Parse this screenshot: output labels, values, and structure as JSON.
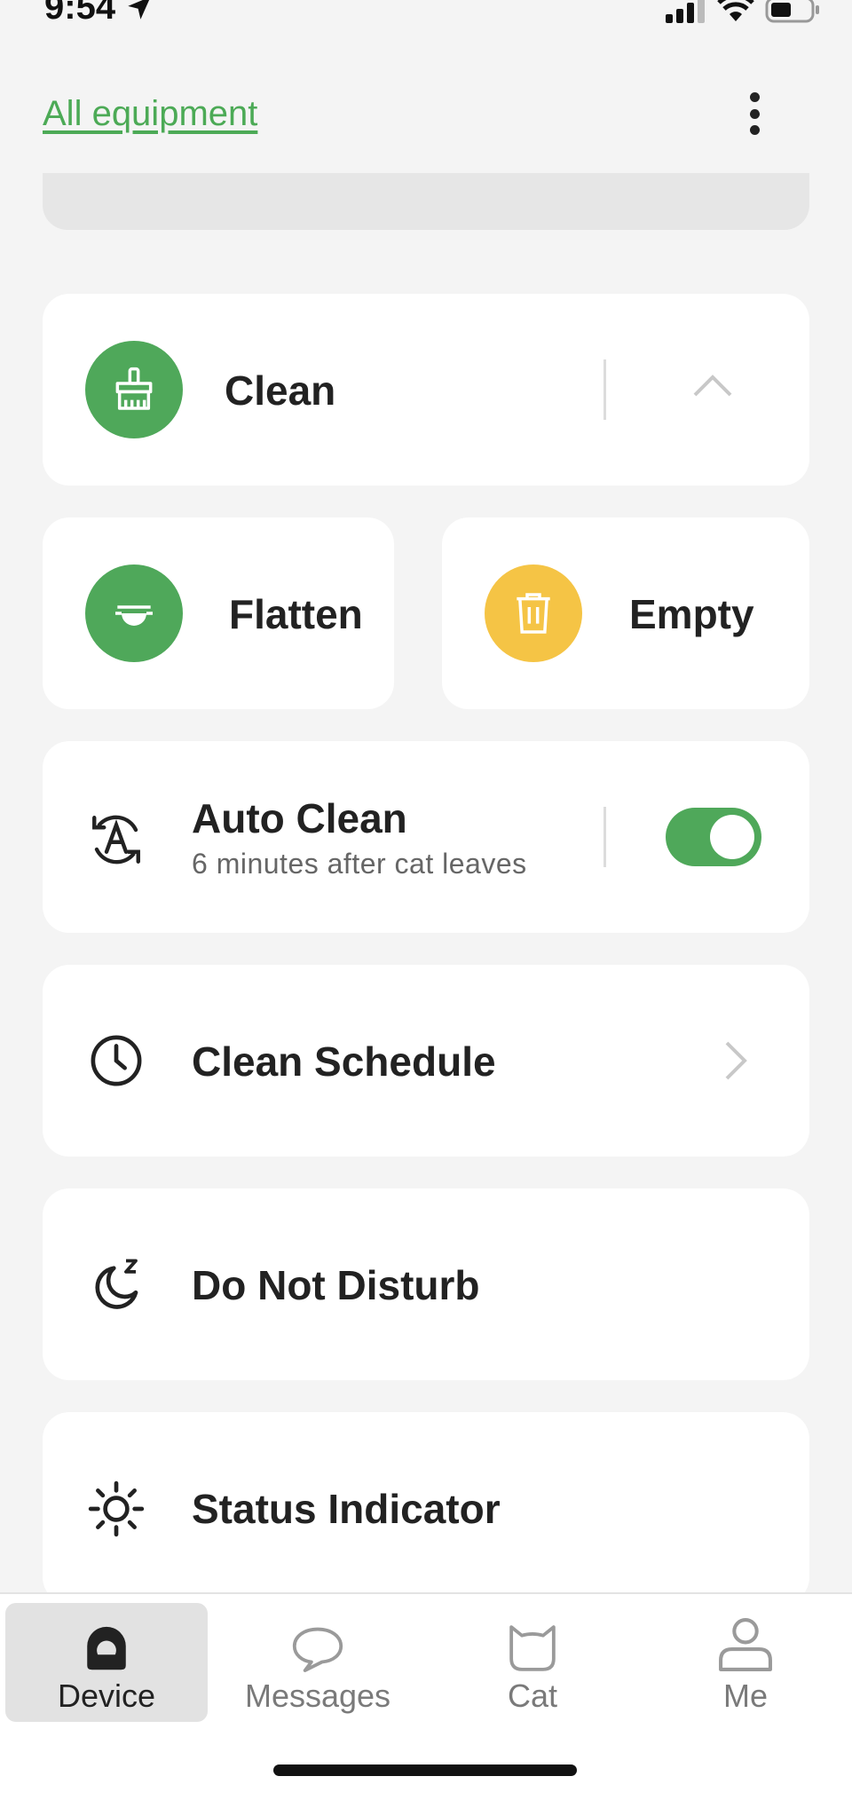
{
  "status_bar": {
    "time": "9:54"
  },
  "header": {
    "all_equipment_link": "All equipment"
  },
  "clean_card": {
    "label": "Clean"
  },
  "flatten_card": {
    "label": "Flatten"
  },
  "empty_card": {
    "label": "Empty"
  },
  "auto_clean": {
    "title": "Auto Clean",
    "subtitle": "6 minutes after cat leaves",
    "enabled": true
  },
  "clean_schedule": {
    "label": "Clean Schedule"
  },
  "do_not_disturb": {
    "label": "Do Not Disturb"
  },
  "status_indicator": {
    "label": "Status Indicator"
  },
  "bottom_nav": {
    "items": [
      {
        "label": "Device",
        "icon": "device-icon",
        "active": true
      },
      {
        "label": "Messages",
        "icon": "message-icon",
        "active": false
      },
      {
        "label": "Cat",
        "icon": "cat-icon",
        "active": false
      },
      {
        "label": "Me",
        "icon": "person-icon",
        "active": false
      }
    ]
  },
  "colors": {
    "accent_green": "#4fa85a",
    "empty_yellow": "#f5c445",
    "background": "#f4f4f4"
  }
}
